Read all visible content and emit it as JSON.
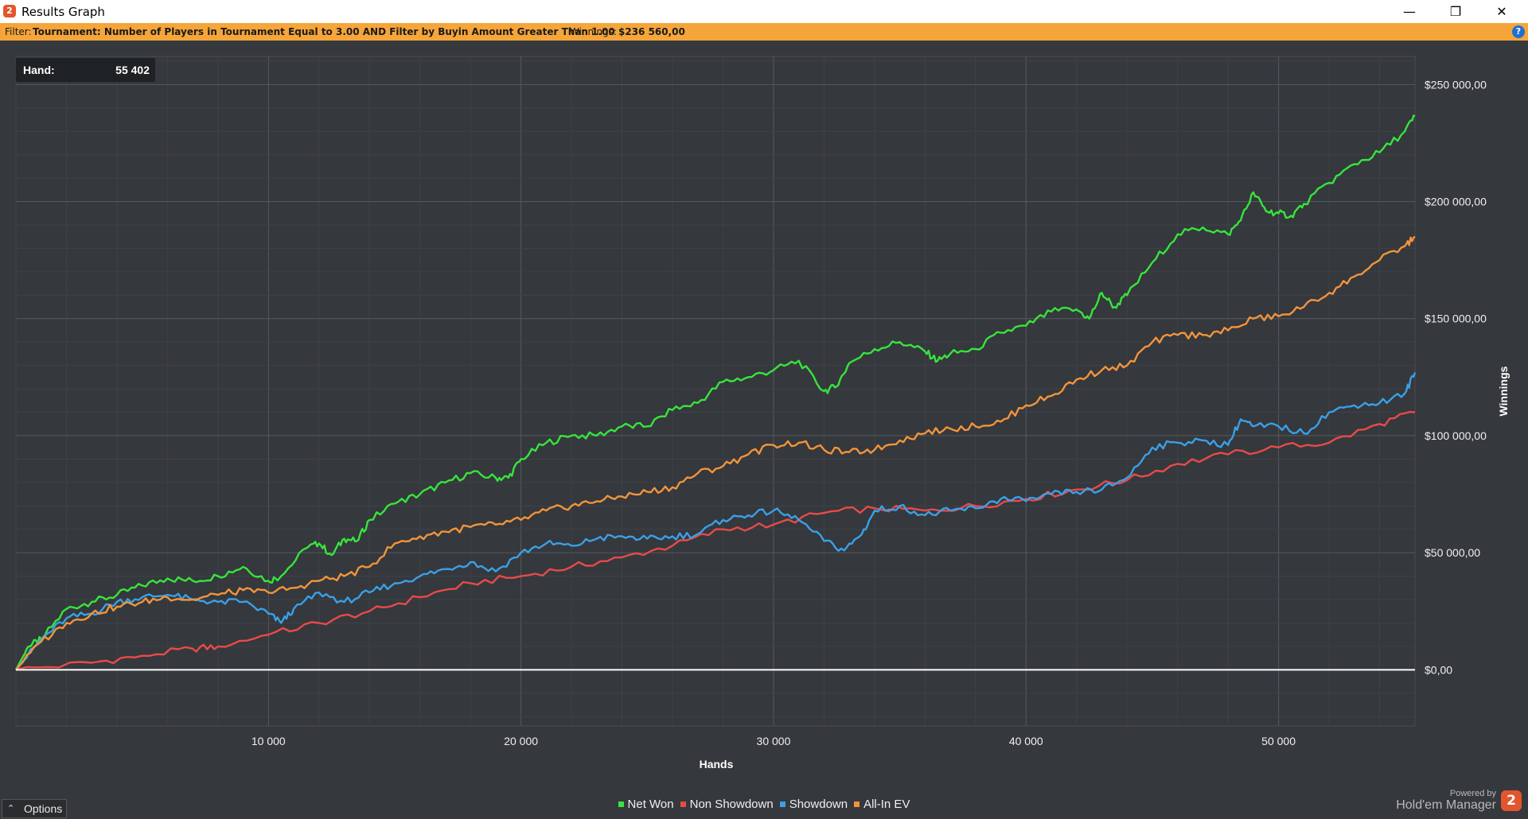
{
  "window": {
    "title": "Results Graph",
    "minimize_glyph": "—",
    "restore_glyph": "❐",
    "close_glyph": "✕",
    "icon": "hm2-logo-icon"
  },
  "filter_bar": {
    "filter_label": "Filter:",
    "filter_text": "Tournament: Number of Players in Tournament Equal to 3.00 AND Filter by Buyin Amount Greater Than 1.00",
    "winnings_label": "Winnings:",
    "winnings_value": "$236 560,00",
    "help_icon": "help-icon"
  },
  "hand_box": {
    "label": "Hand:",
    "value": "55 402"
  },
  "options_button": {
    "label": "Options",
    "icon": "chevron-up-icon"
  },
  "branding": {
    "powered_by": "Powered by",
    "product": "Hold'em Manager",
    "logo_glyph": "2",
    "icon": "hm2-logo-icon"
  },
  "chart_data": {
    "type": "line",
    "xlabel": "Hands",
    "ylabel": "Winnings",
    "xlim": [
      0,
      55402
    ],
    "ylim": [
      -24000,
      262000
    ],
    "x_ticks": [
      10000,
      20000,
      30000,
      40000,
      50000
    ],
    "x_tick_labels": [
      "10 000",
      "20 000",
      "30 000",
      "40 000",
      "50 000"
    ],
    "y_ticks": [
      0,
      50000,
      100000,
      150000,
      200000,
      250000
    ],
    "y_tick_labels": [
      "$0,00",
      "$50 000,00",
      "$100 000,00",
      "$150 000,00",
      "$200 000,00",
      "$250 000,00"
    ],
    "grid": true,
    "legend_position": "bottom",
    "zero_line_color": "#ffffff",
    "background": "#35383c",
    "series": [
      {
        "name": "Net Won",
        "color": "#37e43d",
        "x": [
          0,
          500,
          1000,
          2000,
          3000,
          4000,
          5000,
          6000,
          7000,
          8000,
          9000,
          10000,
          10500,
          11500,
          12000,
          12500,
          13000,
          13500,
          14000,
          15000,
          16000,
          17000,
          18000,
          19000,
          19500,
          20000,
          21000,
          22000,
          23000,
          24000,
          25000,
          26000,
          27000,
          28000,
          29000,
          30000,
          31000,
          32000,
          32500,
          33000,
          34000,
          35000,
          36000,
          36500,
          37000,
          38000,
          39000,
          40000,
          41000,
          42000,
          42500,
          43000,
          43500,
          44000,
          45000,
          46000,
          47000,
          48000,
          48500,
          49000,
          49500,
          50000,
          50500,
          51000,
          52000,
          53000,
          54000,
          55000,
          55402
        ],
        "y": [
          0,
          10000,
          13000,
          26000,
          29000,
          32000,
          36000,
          39000,
          38000,
          40000,
          44000,
          38000,
          40000,
          52000,
          54000,
          49000,
          56000,
          55000,
          64000,
          71000,
          75000,
          80000,
          84000,
          82000,
          82000,
          90000,
          97000,
          100000,
          100000,
          104000,
          104000,
          111000,
          114000,
          123000,
          125000,
          128000,
          132000,
          119000,
          121000,
          131000,
          137000,
          140000,
          136000,
          132000,
          135000,
          137000,
          144000,
          147000,
          153000,
          154000,
          150000,
          161000,
          155000,
          160000,
          174000,
          186000,
          189000,
          186000,
          192000,
          204000,
          196000,
          195000,
          194000,
          199000,
          208000,
          216000,
          221000,
          230000,
          236560
        ]
      },
      {
        "name": "Non Showdown",
        "color": "#e84a4a",
        "x": [
          0,
          3000,
          5000,
          7000,
          8000,
          10000,
          12000,
          14000,
          16000,
          18000,
          20000,
          22000,
          24000,
          26000,
          28000,
          30000,
          32000,
          34000,
          36000,
          38000,
          40000,
          42000,
          44000,
          46000,
          48000,
          50000,
          52000,
          54000,
          55402
        ],
        "y": [
          0,
          3000,
          6000,
          9000,
          10000,
          15000,
          20000,
          25000,
          31000,
          37000,
          40000,
          44000,
          48000,
          53000,
          60000,
          62000,
          67000,
          69000,
          68000,
          70000,
          73000,
          77000,
          81000,
          88000,
          92000,
          95000,
          97000,
          105000,
          110000
        ]
      },
      {
        "name": "Showdown",
        "color": "#3aa0e8",
        "x": [
          0,
          1000,
          2000,
          3000,
          4000,
          5000,
          6000,
          7000,
          8000,
          9000,
          10000,
          10500,
          11000,
          12000,
          13000,
          14000,
          15000,
          16000,
          17000,
          18000,
          19000,
          20000,
          21000,
          22000,
          23000,
          24000,
          25000,
          26000,
          27000,
          28000,
          29000,
          30000,
          31000,
          32000,
          32800,
          33500,
          34000,
          35000,
          36000,
          37000,
          38000,
          39000,
          40000,
          41000,
          42000,
          43000,
          44000,
          45000,
          46000,
          47000,
          48000,
          48500,
          49000,
          50000,
          51000,
          52000,
          53000,
          54000,
          55000,
          55402
        ],
        "y": [
          0,
          13000,
          22000,
          24000,
          29000,
          31000,
          32000,
          30000,
          29000,
          29000,
          24000,
          20000,
          26000,
          33000,
          29000,
          33000,
          37000,
          40000,
          43000,
          46000,
          42000,
          50000,
          54000,
          53000,
          56000,
          57000,
          56000,
          57000,
          58000,
          64000,
          66000,
          68000,
          64000,
          55000,
          51000,
          58000,
          68000,
          70000,
          66000,
          68000,
          69000,
          73000,
          72000,
          75000,
          76000,
          77000,
          82000,
          95000,
          97000,
          98000,
          96000,
          107000,
          104000,
          104000,
          101000,
          110000,
          113000,
          114000,
          118000,
          127000
        ]
      },
      {
        "name": "All-In EV",
        "color": "#f2943b",
        "x": [
          0,
          1000,
          2000,
          3000,
          4000,
          5000,
          6000,
          7000,
          8000,
          9000,
          10000,
          11000,
          12000,
          13000,
          14000,
          15000,
          16000,
          17000,
          18000,
          19000,
          20000,
          21000,
          22000,
          23000,
          24000,
          25000,
          26000,
          27000,
          28000,
          29000,
          30000,
          31000,
          32000,
          33000,
          34000,
          35000,
          36000,
          37000,
          38000,
          39000,
          40000,
          41000,
          42000,
          43000,
          44000,
          45000,
          46000,
          47000,
          48000,
          49000,
          50000,
          51000,
          52000,
          53000,
          54000,
          55000,
          55402
        ],
        "y": [
          0,
          12000,
          20000,
          24000,
          27000,
          29000,
          31000,
          30000,
          32000,
          34000,
          33000,
          35000,
          38000,
          40000,
          44000,
          54000,
          57000,
          59000,
          61000,
          62000,
          64000,
          68000,
          70000,
          72000,
          74000,
          76000,
          78000,
          84000,
          87000,
          92000,
          96000,
          97000,
          94000,
          93000,
          94000,
          98000,
          101000,
          103000,
          104000,
          106000,
          113000,
          117000,
          124000,
          128000,
          130000,
          140000,
          143000,
          143000,
          145000,
          150000,
          151000,
          155000,
          161000,
          168000,
          175000,
          181000,
          185000
        ]
      }
    ]
  }
}
